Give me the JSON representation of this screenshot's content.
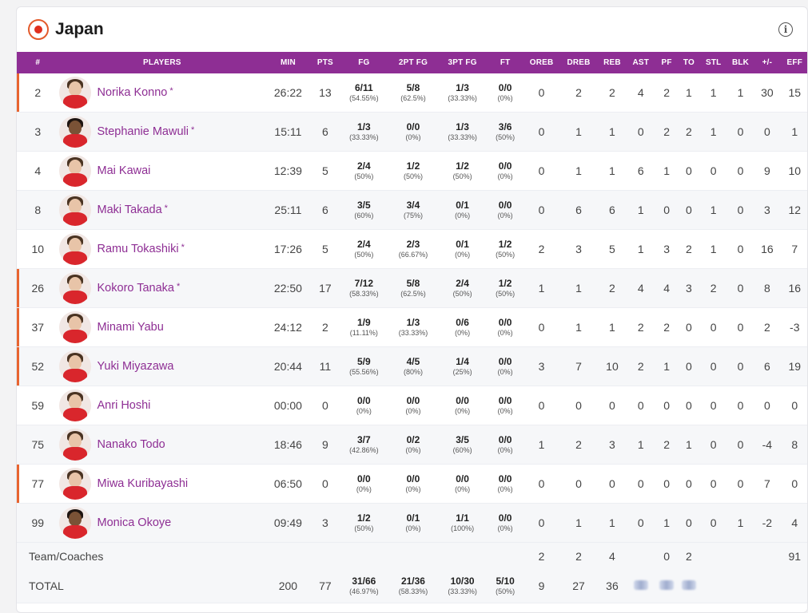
{
  "team": {
    "name": "Japan"
  },
  "columns": [
    "#",
    "PLAYERS",
    "MIN",
    "PTS",
    "FG",
    "2PT FG",
    "3PT FG",
    "FT",
    "OREB",
    "DREB",
    "REB",
    "AST",
    "PF",
    "TO",
    "STL",
    "BLK",
    "+/-",
    "EFF"
  ],
  "players": [
    {
      "num": "2",
      "name": "Norika Konno",
      "star": "*",
      "min": "26:22",
      "pts": "13",
      "fg": "6/11",
      "fg_pct": "(54.55%)",
      "fg2": "5/8",
      "fg2_pct": "(62.5%)",
      "fg3": "1/3",
      "fg3_pct": "(33.33%)",
      "ft": "0/0",
      "ft_pct": "(0%)",
      "oreb": "0",
      "dreb": "2",
      "reb": "2",
      "ast": "4",
      "pf": "2",
      "to": "1",
      "stl": "1",
      "blk": "1",
      "pm": "30",
      "eff": "15"
    },
    {
      "num": "3",
      "name": "Stephanie Mawuli",
      "star": "*",
      "min": "15:11",
      "pts": "6",
      "fg": "1/3",
      "fg_pct": "(33.33%)",
      "fg2": "0/0",
      "fg2_pct": "(0%)",
      "fg3": "1/3",
      "fg3_pct": "(33.33%)",
      "ft": "3/6",
      "ft_pct": "(50%)",
      "oreb": "0",
      "dreb": "1",
      "reb": "1",
      "ast": "0",
      "pf": "2",
      "to": "2",
      "stl": "1",
      "blk": "0",
      "pm": "0",
      "eff": "1"
    },
    {
      "num": "4",
      "name": "Mai Kawai",
      "star": "",
      "min": "12:39",
      "pts": "5",
      "fg": "2/4",
      "fg_pct": "(50%)",
      "fg2": "1/2",
      "fg2_pct": "(50%)",
      "fg3": "1/2",
      "fg3_pct": "(50%)",
      "ft": "0/0",
      "ft_pct": "(0%)",
      "oreb": "0",
      "dreb": "1",
      "reb": "1",
      "ast": "6",
      "pf": "1",
      "to": "0",
      "stl": "0",
      "blk": "0",
      "pm": "9",
      "eff": "10"
    },
    {
      "num": "8",
      "name": "Maki Takada",
      "star": "*",
      "min": "25:11",
      "pts": "6",
      "fg": "3/5",
      "fg_pct": "(60%)",
      "fg2": "3/4",
      "fg2_pct": "(75%)",
      "fg3": "0/1",
      "fg3_pct": "(0%)",
      "ft": "0/0",
      "ft_pct": "(0%)",
      "oreb": "0",
      "dreb": "6",
      "reb": "6",
      "ast": "1",
      "pf": "0",
      "to": "0",
      "stl": "1",
      "blk": "0",
      "pm": "3",
      "eff": "12"
    },
    {
      "num": "10",
      "name": "Ramu Tokashiki",
      "star": "*",
      "min": "17:26",
      "pts": "5",
      "fg": "2/4",
      "fg_pct": "(50%)",
      "fg2": "2/3",
      "fg2_pct": "(66.67%)",
      "fg3": "0/1",
      "fg3_pct": "(0%)",
      "ft": "1/2",
      "ft_pct": "(50%)",
      "oreb": "2",
      "dreb": "3",
      "reb": "5",
      "ast": "1",
      "pf": "3",
      "to": "2",
      "stl": "1",
      "blk": "0",
      "pm": "16",
      "eff": "7"
    },
    {
      "num": "26",
      "name": "Kokoro Tanaka",
      "star": "*",
      "min": "22:50",
      "pts": "17",
      "fg": "7/12",
      "fg_pct": "(58.33%)",
      "fg2": "5/8",
      "fg2_pct": "(62.5%)",
      "fg3": "2/4",
      "fg3_pct": "(50%)",
      "ft": "1/2",
      "ft_pct": "(50%)",
      "oreb": "1",
      "dreb": "1",
      "reb": "2",
      "ast": "4",
      "pf": "4",
      "to": "3",
      "stl": "2",
      "blk": "0",
      "pm": "8",
      "eff": "16"
    },
    {
      "num": "37",
      "name": "Minami Yabu",
      "star": "",
      "min": "24:12",
      "pts": "2",
      "fg": "1/9",
      "fg_pct": "(11.11%)",
      "fg2": "1/3",
      "fg2_pct": "(33.33%)",
      "fg3": "0/6",
      "fg3_pct": "(0%)",
      "ft": "0/0",
      "ft_pct": "(0%)",
      "oreb": "0",
      "dreb": "1",
      "reb": "1",
      "ast": "2",
      "pf": "2",
      "to": "0",
      "stl": "0",
      "blk": "0",
      "pm": "2",
      "eff": "-3"
    },
    {
      "num": "52",
      "name": "Yuki Miyazawa",
      "star": "",
      "min": "20:44",
      "pts": "11",
      "fg": "5/9",
      "fg_pct": "(55.56%)",
      "fg2": "4/5",
      "fg2_pct": "(80%)",
      "fg3": "1/4",
      "fg3_pct": "(25%)",
      "ft": "0/0",
      "ft_pct": "(0%)",
      "oreb": "3",
      "dreb": "7",
      "reb": "10",
      "ast": "2",
      "pf": "1",
      "to": "0",
      "stl": "0",
      "blk": "0",
      "pm": "6",
      "eff": "19"
    },
    {
      "num": "59",
      "name": "Anri Hoshi",
      "star": "",
      "min": "00:00",
      "pts": "0",
      "fg": "0/0",
      "fg_pct": "(0%)",
      "fg2": "0/0",
      "fg2_pct": "(0%)",
      "fg3": "0/0",
      "fg3_pct": "(0%)",
      "ft": "0/0",
      "ft_pct": "(0%)",
      "oreb": "0",
      "dreb": "0",
      "reb": "0",
      "ast": "0",
      "pf": "0",
      "to": "0",
      "stl": "0",
      "blk": "0",
      "pm": "0",
      "eff": "0"
    },
    {
      "num": "75",
      "name": "Nanako Todo",
      "star": "",
      "min": "18:46",
      "pts": "9",
      "fg": "3/7",
      "fg_pct": "(42.86%)",
      "fg2": "0/2",
      "fg2_pct": "(0%)",
      "fg3": "3/5",
      "fg3_pct": "(60%)",
      "ft": "0/0",
      "ft_pct": "(0%)",
      "oreb": "1",
      "dreb": "2",
      "reb": "3",
      "ast": "1",
      "pf": "2",
      "to": "1",
      "stl": "0",
      "blk": "0",
      "pm": "-4",
      "eff": "8"
    },
    {
      "num": "77",
      "name": "Miwa Kuribayashi",
      "star": "",
      "min": "06:50",
      "pts": "0",
      "fg": "0/0",
      "fg_pct": "(0%)",
      "fg2": "0/0",
      "fg2_pct": "(0%)",
      "fg3": "0/0",
      "fg3_pct": "(0%)",
      "ft": "0/0",
      "ft_pct": "(0%)",
      "oreb": "0",
      "dreb": "0",
      "reb": "0",
      "ast": "0",
      "pf": "0",
      "to": "0",
      "stl": "0",
      "blk": "0",
      "pm": "7",
      "eff": "0"
    },
    {
      "num": "99",
      "name": "Monica Okoye",
      "star": "",
      "min": "09:49",
      "pts": "3",
      "fg": "1/2",
      "fg_pct": "(50%)",
      "fg2": "0/1",
      "fg2_pct": "(0%)",
      "fg3": "1/1",
      "fg3_pct": "(100%)",
      "ft": "0/0",
      "ft_pct": "(0%)",
      "oreb": "0",
      "dreb": "1",
      "reb": "1",
      "ast": "0",
      "pf": "1",
      "to": "0",
      "stl": "0",
      "blk": "1",
      "pm": "-2",
      "eff": "4"
    }
  ],
  "team_coaches": {
    "label": "Team/Coaches",
    "oreb": "2",
    "dreb": "2",
    "reb": "4",
    "pf": "0",
    "to": "2",
    "eff": "91"
  },
  "total": {
    "label": "TOTAL",
    "min": "200",
    "pts": "77",
    "fg": "31/66",
    "fg_pct": "(46.97%)",
    "fg2": "21/36",
    "fg2_pct": "(58.33%)",
    "fg3": "10/30",
    "fg3_pct": "(33.33%)",
    "ft": "5/10",
    "ft_pct": "(50%)",
    "oreb": "9",
    "dreb": "27",
    "reb": "36"
  },
  "starter_rows": [
    0,
    5,
    6,
    7,
    10
  ],
  "dark_avatars": [
    1,
    11
  ],
  "colors": {
    "header_bg": "#8e2e94",
    "accent": "#e8642f",
    "link": "#8e2e94"
  }
}
